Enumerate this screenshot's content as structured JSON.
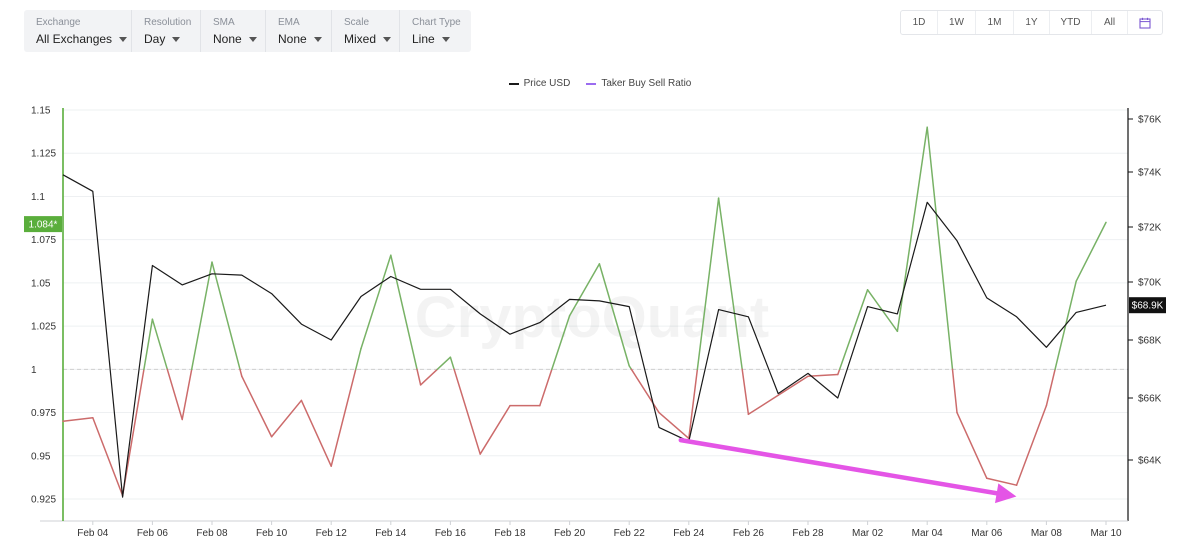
{
  "controls": [
    {
      "label": "Exchange",
      "value": "All Exchanges"
    },
    {
      "label": "Resolution",
      "value": "Day"
    },
    {
      "label": "SMA",
      "value": "None"
    },
    {
      "label": "EMA",
      "value": "None"
    },
    {
      "label": "Scale",
      "value": "Mixed"
    },
    {
      "label": "Chart Type",
      "value": "Line"
    }
  ],
  "ranges": [
    "1D",
    "1W",
    "1M",
    "1Y",
    "YTD",
    "All"
  ],
  "watermark": "CryptoQuant",
  "colors": {
    "price": "#1a1a1a",
    "ratio_up": "#78b266",
    "ratio_down": "#cc6b6b",
    "ratio_legend": "#9b6cf0",
    "badge_left": "#5aae3c",
    "badge_right": "#111111",
    "arrow": "#e455e6",
    "grid": "#eef0f2",
    "reference": "#cfcfcf"
  },
  "chart_data": {
    "type": "line",
    "legend": [
      "Price USD",
      "Taker Buy Sell Ratio"
    ],
    "x_tick_labels": [
      "Feb 04",
      "Feb 06",
      "Feb 08",
      "Feb 10",
      "Feb 12",
      "Feb 14",
      "Feb 16",
      "Feb 18",
      "Feb 20",
      "Feb 22",
      "Feb 24",
      "Feb 26",
      "Feb 28",
      "Mar 02",
      "Mar 04",
      "Mar 06",
      "Mar 08",
      "Mar 10"
    ],
    "x": [
      "Feb 03",
      "Feb 04",
      "Feb 05",
      "Feb 06",
      "Feb 07",
      "Feb 08",
      "Feb 09",
      "Feb 10",
      "Feb 11",
      "Feb 12",
      "Feb 13",
      "Feb 14",
      "Feb 15",
      "Feb 16",
      "Feb 17",
      "Feb 18",
      "Feb 19",
      "Feb 20",
      "Feb 21",
      "Feb 22",
      "Feb 23",
      "Feb 24",
      "Feb 25",
      "Feb 26",
      "Feb 27",
      "Feb 28",
      "Mar 01",
      "Mar 02",
      "Mar 03",
      "Mar 04",
      "Mar 05",
      "Mar 06",
      "Mar 07",
      "Mar 08",
      "Mar 09",
      "Mar 10"
    ],
    "series": [
      {
        "name": "Taker Buy Sell Ratio",
        "axis": "left",
        "values": [
          0.97,
          0.972,
          0.927,
          1.029,
          0.971,
          1.062,
          0.996,
          0.961,
          0.982,
          0.944,
          1.012,
          1.066,
          0.991,
          1.007,
          0.951,
          0.979,
          0.979,
          1.031,
          1.061,
          1.002,
          0.975,
          0.96,
          1.099,
          0.974,
          0.985,
          0.996,
          0.997,
          1.046,
          1.022,
          1.14,
          0.975,
          0.937,
          0.933,
          0.979,
          1.051,
          1.085
        ]
      },
      {
        "name": "Price USD",
        "axis": "right",
        "values": [
          73900,
          73300,
          62800,
          70600,
          69900,
          70300,
          70250,
          69600,
          68550,
          68000,
          69500,
          70200,
          69750,
          69750,
          68900,
          68200,
          68600,
          69400,
          69350,
          69150,
          65050,
          64600,
          69050,
          68800,
          66150,
          66850,
          66000,
          69150,
          68900,
          72900,
          71500,
          69450,
          68800,
          67750,
          68950,
          69200
        ]
      }
    ],
    "y_left": {
      "ticks": [
        0.925,
        0.95,
        0.975,
        1,
        1.025,
        1.05,
        1.075,
        1.1,
        1.125,
        1.15
      ],
      "tick_labels": [
        "0.925",
        "0.95",
        "0.975",
        "1",
        "1.025",
        "1.05",
        "1.075",
        "1.1",
        "1.125",
        "1.15"
      ],
      "ylim": [
        0.925,
        1.15
      ],
      "reference": 1
    },
    "y_right": {
      "ticks": [
        64000,
        66000,
        68000,
        70000,
        72000,
        74000,
        76000
      ],
      "tick_labels": [
        "$64K",
        "$66K",
        "$68K",
        "$70K",
        "$72K",
        "$74K",
        "$76K"
      ],
      "scale": "mixed"
    },
    "badges": {
      "left": "1.084*",
      "left_value": 1.084,
      "right": "$68.9K",
      "right_value": 69200
    },
    "annotation": {
      "type": "arrow",
      "from": {
        "x": "Feb 24",
        "y": 0.955
      },
      "to": {
        "x": "Mar 08",
        "y": 0.927
      }
    }
  }
}
